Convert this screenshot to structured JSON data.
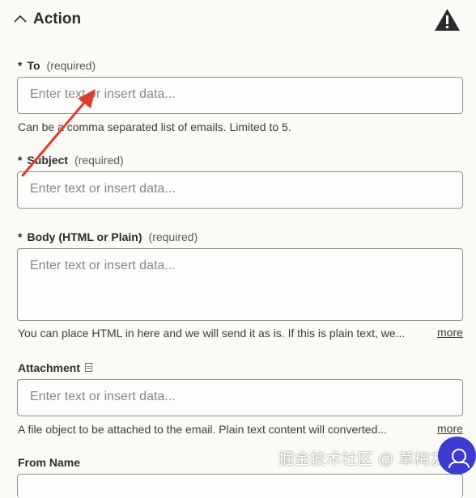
{
  "header": {
    "title": "Action",
    "collapse_icon": "chevron-up-icon",
    "warning_icon": "warning-icon",
    "warning_color": "#2b2b2b"
  },
  "fields": {
    "to": {
      "star": "*",
      "label": "To",
      "required": "(required)",
      "placeholder": "Enter text or insert data...",
      "help": "Can be a comma separated list of emails. Limited to 5."
    },
    "subject": {
      "star": "*",
      "label": "Subject",
      "required": "(required)",
      "placeholder": "Enter text or insert data..."
    },
    "body": {
      "star": "*",
      "label": "Body (HTML or Plain)",
      "required": "(required)",
      "placeholder": "Enter text or insert data...",
      "help": "You can place HTML in here and we will send it as is. If this is plain text, we...",
      "more": "more"
    },
    "attachment": {
      "label": "Attachment",
      "icon": "document-icon",
      "placeholder": "Enter text or insert data...",
      "help": "A file object to be attached to the email. Plain text content will converted...",
      "more": "more"
    },
    "from_name": {
      "label": "From Name"
    }
  },
  "annotation": {
    "arrow_color": "#e03b2f"
  },
  "watermark": {
    "text": "掘金技术社区 @ 草梅友仁"
  }
}
